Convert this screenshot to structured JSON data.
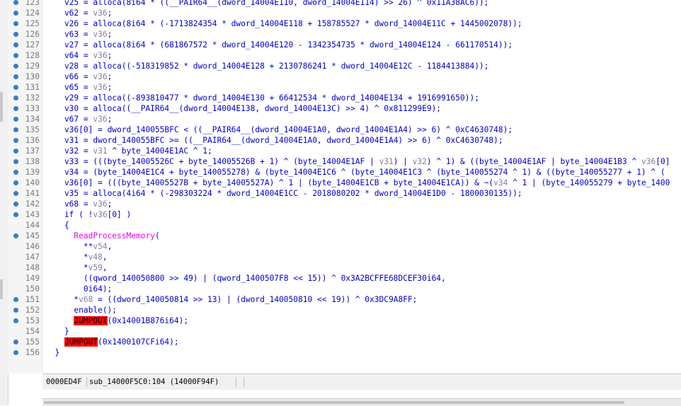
{
  "lines": [
    {
      "n": "123",
      "bp": true,
      "s": [
        [
          "    v25 = alloca(8i64 * ((__PAIR64__(dword_14004E110, dword_14004E114) >> 26) ^ 0x11A38AC6));",
          ""
        ]
      ]
    },
    {
      "n": "124",
      "bp": true,
      "s": [
        [
          "    v62 = v36;",
          ""
        ]
      ]
    },
    {
      "n": "125",
      "bp": true,
      "s": [
        [
          "    v26 = alloca(8i64 * (-1713824354 * dword_14004E118 + 158785527 * dword_14004E11C + 1445002078));",
          ""
        ]
      ]
    },
    {
      "n": "126",
      "bp": true,
      "s": [
        [
          "    v63 = v36;",
          ""
        ]
      ]
    },
    {
      "n": "127",
      "bp": true,
      "s": [
        [
          "    v27 = alloca(8i64 * (681867572 * dword_14004E120 - 1342354735 * dword_14004E124 - 661170514));",
          ""
        ]
      ]
    },
    {
      "n": "128",
      "bp": true,
      "s": [
        [
          "    v64 = v36;",
          ""
        ]
      ]
    },
    {
      "n": "129",
      "bp": true,
      "s": [
        [
          "    v28 = alloca((-518319852 * dword_14004E128 + 2130786241 * dword_14004E12C - 1184413884));",
          ""
        ]
      ]
    },
    {
      "n": "130",
      "bp": true,
      "s": [
        [
          "    v66 = v36;",
          ""
        ]
      ]
    },
    {
      "n": "131",
      "bp": true,
      "s": [
        [
          "    v65 = v36;",
          ""
        ]
      ]
    },
    {
      "n": "132",
      "bp": true,
      "s": [
        [
          "    v29 = alloca((-893810477 * dword_14004E130 + 66412534 * dword_14004E134 + 1916991650));",
          ""
        ]
      ]
    },
    {
      "n": "133",
      "bp": true,
      "s": [
        [
          "    v30 = alloca((__PAIR64__(dword_14004E138, dword_14004E13C) >> 4) ^ 0x811299E9);",
          ""
        ]
      ]
    },
    {
      "n": "134",
      "bp": true,
      "s": [
        [
          "    v67 = v36;",
          ""
        ]
      ]
    },
    {
      "n": "135",
      "bp": true,
      "s": [
        [
          "    v36[0] = dword_140055BFC < ((__PAIR64__(dword_14004E1A0, dword_14004E1A4) >> 6) ^ 0xC4630748);",
          ""
        ]
      ]
    },
    {
      "n": "136",
      "bp": true,
      "s": [
        [
          "    v31 = dword_140055BFC >= ((__PAIR64__(dword_14004E1A0, dword_14004E1A4) >> 6) ^ 0xC4630748);",
          ""
        ]
      ]
    },
    {
      "n": "137",
      "bp": true,
      "s": [
        [
          "    v32 = v31 ^ byte_14004E1AC ^ 1;",
          ""
        ]
      ]
    },
    {
      "n": "138",
      "bp": true,
      "s": [
        [
          "    v33 = (((byte_14005526C + byte_14005526B + 1) ^ (byte_14004E1AF | v31) | v32) ^ 1) & ((byte_14004E1AF | byte_14004E1B3 ^ v36[0]",
          ""
        ]
      ]
    },
    {
      "n": "139",
      "bp": true,
      "s": [
        [
          "    v34 = (byte_14004E1C4 + byte_140055278) & (byte_14004E1C6 ^ (byte_14004E1C3 ^ (byte_140055274 ^ 1) & ((byte_140055277 + 1) ^ (",
          ""
        ]
      ]
    },
    {
      "n": "140",
      "bp": true,
      "s": [
        [
          "    v36[0] = (((byte_14005527B + byte_14005527A) ^ 1 | (byte_14004E1CB + byte_14004E1CA)) & ~(v34 ^ 1 | (byte_140055279 + byte_1400",
          ""
        ]
      ]
    },
    {
      "n": "141",
      "bp": true,
      "s": [
        [
          "    v35 = alloca(4i64 * (-298303224 * dword_14004E1CC - 2018080202 * dword_14004E1D0 - 1800030135));",
          ""
        ]
      ]
    },
    {
      "n": "142",
      "bp": true,
      "s": [
        [
          "    v68 = v36;",
          ""
        ]
      ]
    },
    {
      "n": "143",
      "bp": true,
      "s": [
        [
          "    if ( !v36[0] )",
          ""
        ]
      ]
    },
    {
      "n": "144",
      "bp": false,
      "s": [
        [
          "    {",
          ""
        ]
      ]
    },
    {
      "n": "145",
      "bp": true,
      "s": [
        [
          "      ",
          ""
        ],
        [
          "ReadProcessMemory",
          "fn"
        ],
        [
          "(",
          ""
        ]
      ]
    },
    {
      "n": "146",
      "bp": false,
      "s": [
        [
          "        **v54,",
          ""
        ]
      ]
    },
    {
      "n": "147",
      "bp": false,
      "s": [
        [
          "        *v48,",
          ""
        ]
      ]
    },
    {
      "n": "148",
      "bp": false,
      "s": [
        [
          "        *v59,",
          ""
        ]
      ]
    },
    {
      "n": "149",
      "bp": false,
      "s": [
        [
          "        ((qword_140050800 >> 49) | (qword_1400507F8 << 15)) ^ 0x3A2BCFFE68DCEF30i64,",
          ""
        ]
      ]
    },
    {
      "n": "150",
      "bp": false,
      "s": [
        [
          "        0i64);",
          ""
        ]
      ]
    },
    {
      "n": "151",
      "bp": true,
      "s": [
        [
          "      *v68 = ((dword_140050814 >> 13) | (dword_140050810 << 19)) ^ 0x3DC9A8FF;",
          ""
        ]
      ]
    },
    {
      "n": "152",
      "bp": true,
      "s": [
        [
          "      enable();",
          ""
        ]
      ]
    },
    {
      "n": "153",
      "bp": true,
      "s": [
        [
          "      ",
          ""
        ],
        [
          "JUMPOUT",
          "jmp"
        ],
        [
          "(0x14001B876i64);",
          ""
        ]
      ]
    },
    {
      "n": "154",
      "bp": false,
      "s": [
        [
          "    }",
          ""
        ]
      ]
    },
    {
      "n": "155",
      "bp": true,
      "s": [
        [
          "    ",
          ""
        ],
        [
          "JUMPOUT",
          "jmp"
        ],
        [
          "(0x1400107CFi64);",
          ""
        ]
      ]
    },
    {
      "n": "156",
      "bp": true,
      "s": [
        [
          "  }",
          ""
        ]
      ]
    }
  ],
  "status": {
    "offset": "0000ED4F",
    "location": "sub_14000F5C0:104 (14000F94F)"
  }
}
